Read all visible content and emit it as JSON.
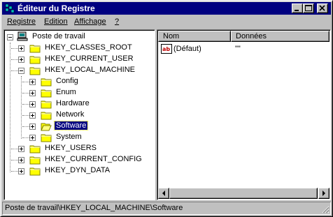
{
  "window": {
    "title": "Éditeur du Registre"
  },
  "menubar": [
    {
      "label": "Registre"
    },
    {
      "label": "Edition"
    },
    {
      "label": "Affichage"
    },
    {
      "label": "?"
    }
  ],
  "tree": {
    "root": "Poste de travail",
    "nodes": [
      {
        "label": "HKEY_CLASSES_ROOT",
        "expander": "+"
      },
      {
        "label": "HKEY_CURRENT_USER",
        "expander": "+"
      },
      {
        "label": "HKEY_LOCAL_MACHINE",
        "expander": "-",
        "children": [
          {
            "label": "Config",
            "expander": "+"
          },
          {
            "label": "Enum",
            "expander": "+"
          },
          {
            "label": "Hardware",
            "expander": "+"
          },
          {
            "label": "Network",
            "expander": "+"
          },
          {
            "label": "Software",
            "expander": "+",
            "selected": true
          },
          {
            "label": "System",
            "expander": "+"
          }
        ]
      },
      {
        "label": "HKEY_USERS",
        "expander": "+"
      },
      {
        "label": "HKEY_CURRENT_CONFIG",
        "expander": "+"
      },
      {
        "label": "HKEY_DYN_DATA",
        "expander": "+"
      }
    ]
  },
  "list": {
    "columns": [
      "Nom",
      "Données"
    ],
    "rows": [
      {
        "name": "(Défaut)",
        "data": "\"\""
      }
    ]
  },
  "status": {
    "path": "Poste de travail\\HKEY_LOCAL_MACHINE\\Software"
  },
  "colors": {
    "titlebar": "#000080",
    "face": "#c0c0c0",
    "folder": "#ffff00",
    "selection": "#000080"
  }
}
